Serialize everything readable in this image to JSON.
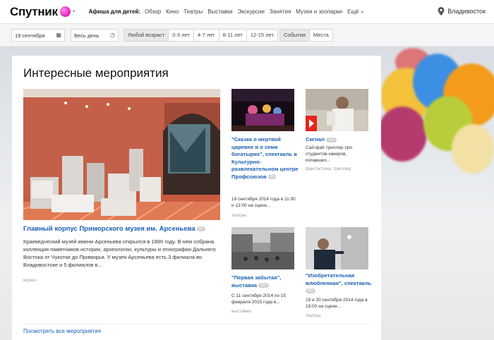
{
  "header": {
    "logo_text": "Спутник",
    "nav_label": "Афиша для детей:",
    "nav_items": [
      "Обзор",
      "Кино",
      "Театры",
      "Выставки",
      "Экскурсии",
      "Занятия",
      "Музеи и зоопарки"
    ],
    "nav_more": "Ещё",
    "city": "Владивосток"
  },
  "filters": {
    "date": "19 сентября",
    "time": "Весь день",
    "ages": [
      "Любой возраст",
      "0-3 лет",
      "4-7 лет",
      "8-11 лет",
      "12-15 лет"
    ],
    "types": [
      "События",
      "Места"
    ]
  },
  "main": {
    "title": "Интересные мероприятия",
    "see_all": "Посмотреть все мероприятия",
    "featured": {
      "title": "Главный корпус Приморского музея им. Арсеньева",
      "badge": "0+",
      "description": "Краеведческий музей имени Арсеньева открылся в 1890 году. В нем собрана коллекция памятников истории, археологии, культуры и этнографии Дальнего Востока от Чукотки до Приморья. У музея Арсеньева есть 3 филиала во Владивостоке и 5 филиалов в...",
      "tag": "музеи"
    },
    "events": [
      {
        "title": "\"Сказка о мертвой царевне и о семи богатырях\", спектакль в Культурно-развлекательном центре Профсоюзов",
        "badge": "0+",
        "description": "19 сентября 2014 года в 11:00 и 13:00 на сцене...",
        "tag": "театры"
      },
      {
        "title": "Сигнал",
        "badge": "12+",
        "description": "Сай-фай триллер про студентов-хакеров, попавших...",
        "tag": "фантастика, триллер"
      },
      {
        "title": "\"Первая забытая\", выставка",
        "badge": "12+",
        "description": "С 11 сентября 2014 по 15 февраля 2015 года в...",
        "tag": "выставки"
      },
      {
        "title": "\"Изобретательная влюбленная\", спектакль",
        "badge": "16+",
        "description": "19 и 20 сентября 2014 года в 19:00 на сцене...",
        "tag": "театры"
      }
    ]
  }
}
